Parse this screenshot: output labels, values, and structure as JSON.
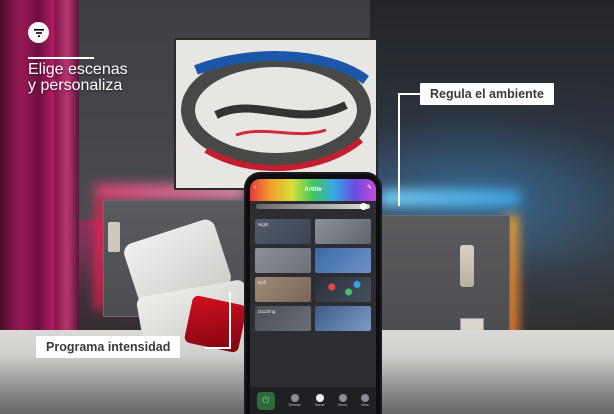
{
  "overlay": {
    "headline": "Elige escenas\ny personaliza",
    "label_ambient": "Regula el ambiente",
    "label_intensity": "Programa intensidad",
    "filter_icon": "filter-icon"
  },
  "phone": {
    "app_title": "Artlite",
    "tiles": [
      {
        "label": "Night"
      },
      {
        "label": ""
      },
      {
        "label": ""
      },
      {
        "label": ""
      },
      {
        "label": "Soft"
      },
      {
        "label": ""
      },
      {
        "label": "Dazzling"
      },
      {
        "label": ""
      }
    ],
    "tabs": [
      {
        "label": "Dimmer",
        "icon": "bulb-icon"
      },
      {
        "label": "Scene",
        "icon": "scene-icon",
        "active": true
      },
      {
        "label": "Music",
        "icon": "music-icon"
      },
      {
        "label": "More",
        "icon": "grid-icon"
      }
    ],
    "slider_level": 0.95
  },
  "colors": {
    "accent_pink": "#ff3d7f",
    "accent_blue": "#3fa6e6",
    "label_bg": "#ffffff"
  }
}
